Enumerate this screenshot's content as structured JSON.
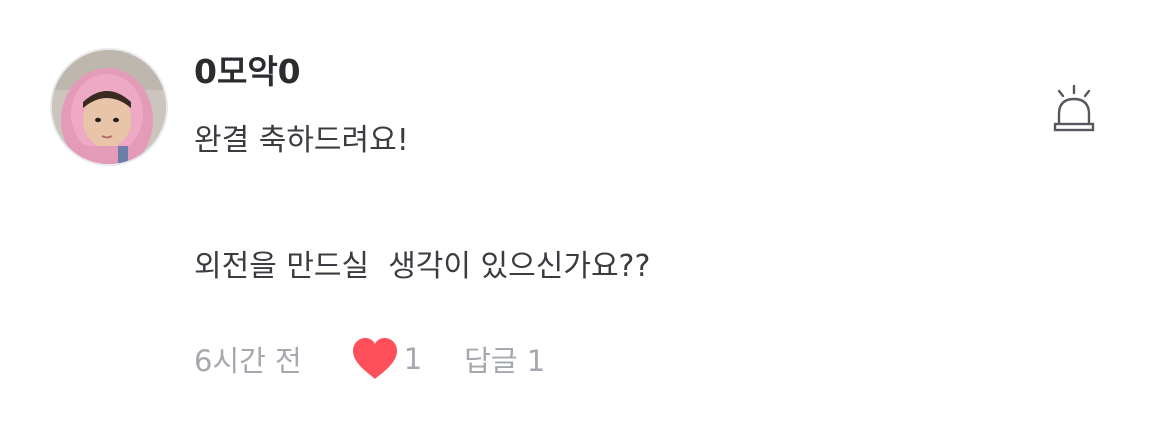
{
  "comment": {
    "username": "0모악0",
    "body_line_1": "완결 축하드려요!",
    "body_line_2": "외전을 만드실  생각이 있으신가요??",
    "timestamp": "6시간 전",
    "like_count": "1",
    "reply_label": "답글 1",
    "liked": true
  },
  "icons": {
    "report": "siren-icon",
    "like": "heart-icon"
  },
  "colors": {
    "heart": "#ff4f5a",
    "meta_text": "#a5a8ae",
    "username": "#2a2c30"
  }
}
